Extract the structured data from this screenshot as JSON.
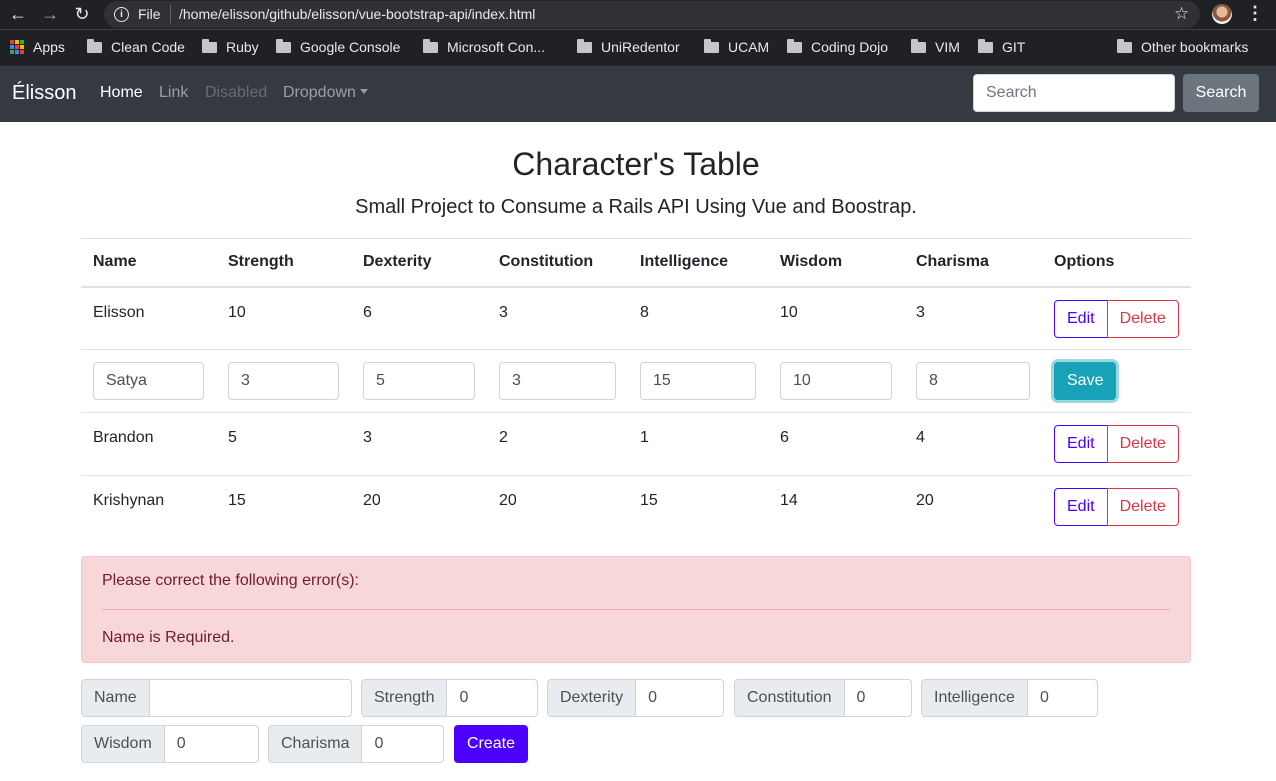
{
  "browser": {
    "file_label": "File",
    "url": "/home/elisson/github/elisson/vue-bootstrap-api/index.html",
    "bookmarks": [
      "Apps",
      "Clean Code",
      "Ruby",
      "Google Console",
      "Microsoft Con...",
      "UniRedentor",
      "UCAM",
      "Coding Dojo",
      "VIM",
      "GIT",
      "Other bookmarks"
    ]
  },
  "navbar": {
    "brand": "Élisson",
    "links": [
      "Home",
      "Link",
      "Disabled",
      "Dropdown"
    ],
    "search_placeholder": "Search",
    "search_button": "Search"
  },
  "page": {
    "title": "Character's Table",
    "subtitle": "Small Project to Consume a Rails API Using Vue and Boostrap."
  },
  "table": {
    "headers": [
      "Name",
      "Strength",
      "Dexterity",
      "Constitution",
      "Intelligence",
      "Wisdom",
      "Charisma",
      "Options"
    ],
    "rows": [
      {
        "name": "Elisson",
        "strength": "10",
        "dexterity": "6",
        "constitution": "3",
        "intelligence": "8",
        "wisdom": "10",
        "charisma": "3"
      },
      {
        "name": "Satya",
        "strength": "3",
        "dexterity": "5",
        "constitution": "3",
        "intelligence": "15",
        "wisdom": "10",
        "charisma": "8"
      },
      {
        "name": "Brandon",
        "strength": "5",
        "dexterity": "3",
        "constitution": "2",
        "intelligence": "1",
        "wisdom": "6",
        "charisma": "4"
      },
      {
        "name": "Krishynan",
        "strength": "15",
        "dexterity": "20",
        "constitution": "20",
        "intelligence": "15",
        "wisdom": "14",
        "charisma": "20"
      }
    ],
    "edit_label": "Edit",
    "delete_label": "Delete",
    "save_label": "Save"
  },
  "alert": {
    "heading": "Please correct the following error(s):",
    "message": "Name is Required."
  },
  "form": {
    "fields": [
      {
        "label": "Name",
        "value": ""
      },
      {
        "label": "Strength",
        "value": "0"
      },
      {
        "label": "Dexterity",
        "value": "0"
      },
      {
        "label": "Constitution",
        "value": "0"
      },
      {
        "label": "Intelligence",
        "value": "0"
      },
      {
        "label": "Wisdom",
        "value": "0"
      },
      {
        "label": "Charisma",
        "value": "0"
      }
    ],
    "create_label": "Create"
  },
  "colors": {
    "primary": "#4b00ff",
    "danger": "#dc3545",
    "info": "#17a2b8",
    "navbar": "#343a40"
  }
}
